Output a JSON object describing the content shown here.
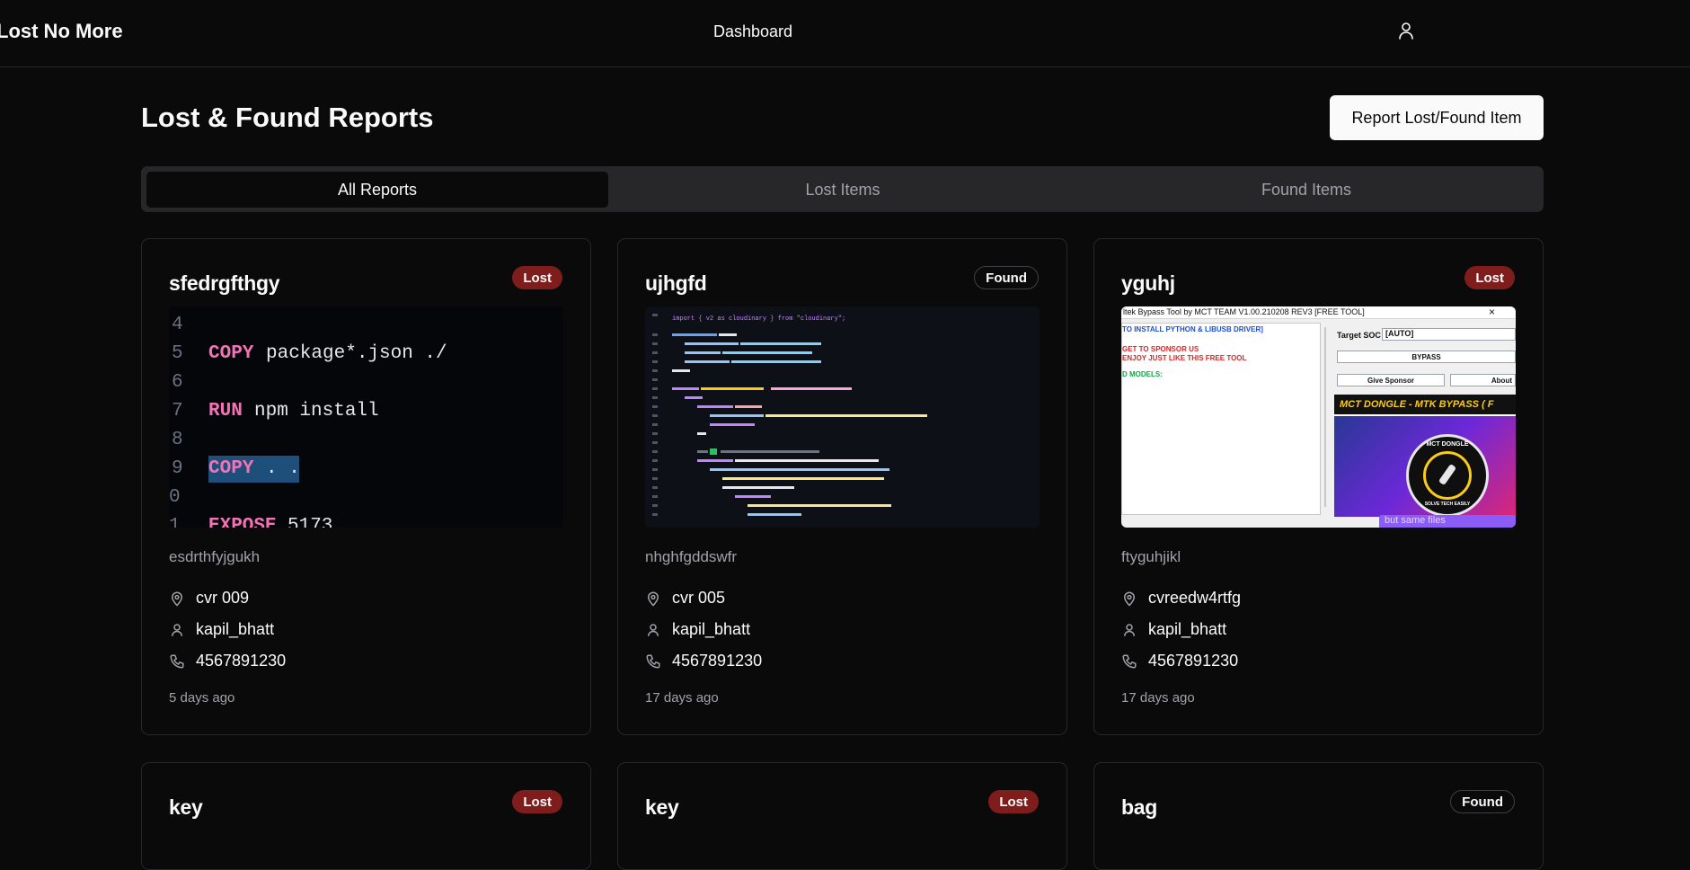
{
  "app": {
    "brand": "Lost No More",
    "nav_dashboard": "Dashboard",
    "user_icon": "user-icon"
  },
  "page": {
    "title": "Lost & Found Reports",
    "report_button": "Report Lost/Found Item"
  },
  "tabs": [
    {
      "label": "All Reports",
      "active": true
    },
    {
      "label": "Lost Items",
      "active": false
    },
    {
      "label": "Found Items",
      "active": false
    }
  ],
  "cards": [
    {
      "title": "sfedrgfthgy",
      "status": "Lost",
      "description": "esdrthfyjgukh",
      "location": "cvr 009",
      "user": "kapil_bhatt",
      "phone": "4567891230",
      "time": "5 days ago",
      "code": {
        "lines": [
          {
            "num": "4",
            "kw": "",
            "text": ""
          },
          {
            "num": "5",
            "kw": "COPY",
            "text": "package*.json ./"
          },
          {
            "num": "6",
            "kw": "",
            "text": ""
          },
          {
            "num": "7",
            "kw": "RUN",
            "text": "npm install"
          },
          {
            "num": "8",
            "kw": "",
            "text": ""
          },
          {
            "num": "9",
            "kw": "COPY",
            "text": ". ."
          },
          {
            "num": "0",
            "kw": "",
            "text": ""
          },
          {
            "num": "1",
            "kw": "EXPOSE",
            "text": "5173"
          }
        ]
      }
    },
    {
      "title": "ujhgfd",
      "status": "Found",
      "description": "nhghfgddswfr",
      "location": "cvr 005",
      "user": "kapil_bhatt",
      "phone": "4567891230",
      "time": "17 days ago",
      "code_snippet": "import { v2 as cloudinary } from \"cloudinary\";"
    },
    {
      "title": "yguhj",
      "status": "Lost",
      "description": "ftyguhjikl",
      "location": "cvreedw4rtfg",
      "user": "kapil_bhatt",
      "phone": "4567891230",
      "time": "17 days ago",
      "window": {
        "title": "ltek Bypass Tool by MCT TEAM V1.00.210208 REV3 [FREE TOOL]",
        "close": "×",
        "line1": "TO INSTALL PYTHON & LIBUSB DRIVER]",
        "line2": "GET TO SPONSOR US",
        "line3": "ENJOY JUST LIKE THIS FREE TOOL",
        "line4": "D MODELS:",
        "target_label": "Target SOC",
        "target_value": "[AUTO]",
        "bypass": "BYPASS",
        "sponsor": "Give Sponsor",
        "about": "About",
        "banner": "MCT DONGLE - MTK BYPASS ( F",
        "logo_top": "MCT DONGLE",
        "logo_bottom": "SOLVE TECH EASILY",
        "footer": "but same files"
      }
    },
    {
      "title": "key",
      "status": "Lost"
    },
    {
      "title": "key",
      "status": "Lost"
    },
    {
      "title": "bag",
      "status": "Found"
    }
  ],
  "colors": {
    "background": "#0a0a0a",
    "lost_badge": "#7f1d1d",
    "border": "#27272a",
    "muted": "#a1a1aa"
  }
}
